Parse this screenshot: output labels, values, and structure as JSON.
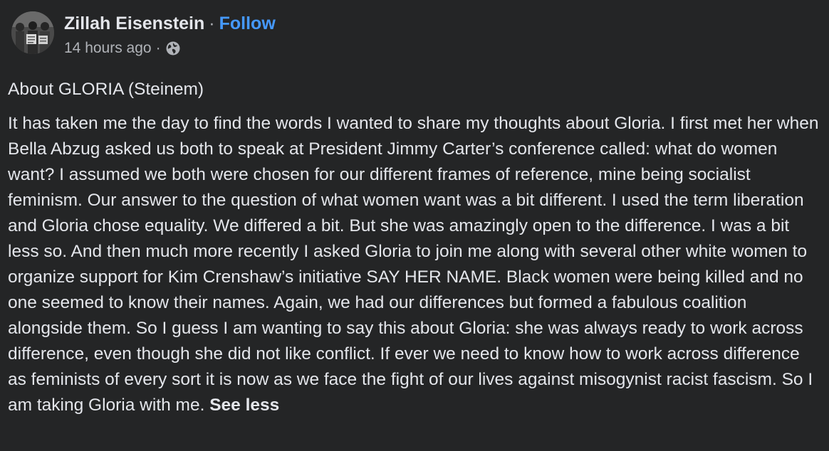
{
  "post": {
    "author": "Zillah Eisenstein",
    "separator": "·",
    "follow_label": "Follow",
    "timestamp": "14 hours ago",
    "audience_icon": "globe-icon",
    "title": "About GLORIA (Steinem)",
    "body": "It has taken me the day to find the words I wanted to share my thoughts about Gloria. I first met her when Bella Abzug asked us both to speak at President Jimmy Carter’s conference called: what do women want? I assumed we both were chosen for our different frames of reference, mine being socialist feminism. Our answer to the question of what women want was a bit different. I used the term liberation and Gloria chose equality. We differed a bit. But she was amazingly open to the difference. I was a bit less so. And then much more recently I asked Gloria to join me along with several other white women to organize support for Kim Crenshaw’s initiative SAY HER NAME. Black women were being killed and no one seemed to know their names. Again, we had our differences but formed a fabulous coalition alongside them. So I guess I am wanting to say this about Gloria: she was always ready to work across difference, even though she did not like conflict. If ever we need to know how to work across difference as feminists of every sort it is now as we face the fight of our lives against misogynist racist fascism. So I am taking Gloria with me.",
    "see_less_label": "See less"
  },
  "colors": {
    "background": "#242526",
    "text_primary": "#e4e6eb",
    "text_secondary": "#b0b3b8",
    "link": "#4599ff"
  }
}
